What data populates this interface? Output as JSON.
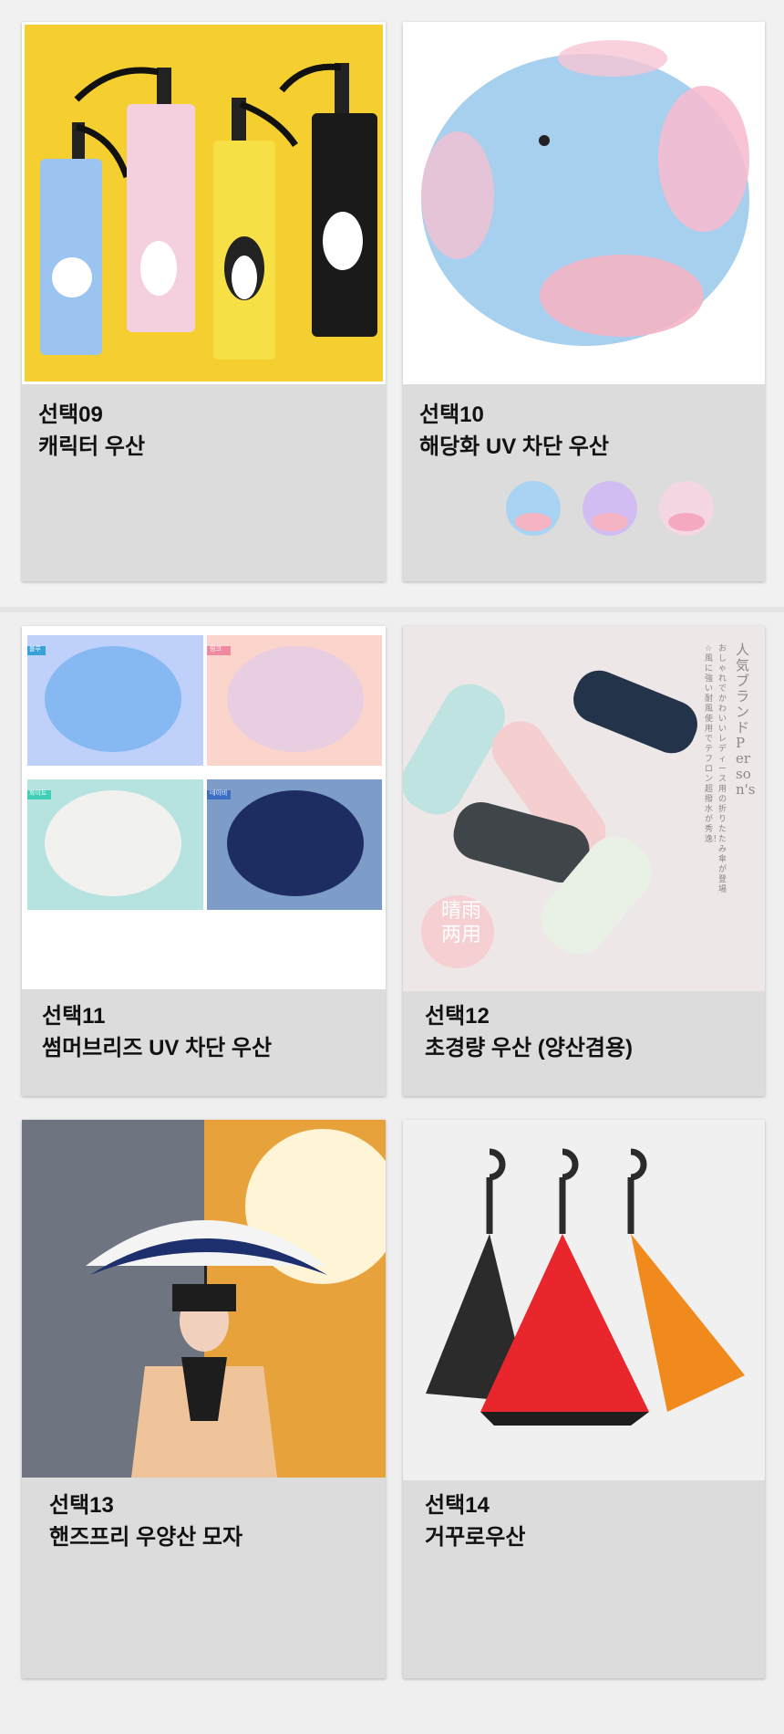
{
  "products": [
    {
      "code": "선택09",
      "name": "캐릭터 우산",
      "icon": "character-umbrella-photo"
    },
    {
      "code": "선택10",
      "name": "해당화 UV 차단 우산",
      "icon": "flower-uv-umbrella-photo"
    },
    {
      "code": "선택11",
      "name": "썸머브리즈 UV 차단 우산",
      "icon": "summer-breeze-umbrella-photo"
    },
    {
      "code": "선택12",
      "name": "초경량 우산 (양산겸용)",
      "icon": "ultralight-umbrella-photo"
    },
    {
      "code": "선택13",
      "name": "핸즈프리 우양산 모자",
      "icon": "handsfree-umbrella-hat-photo"
    },
    {
      "code": "선택14",
      "name": "거꾸로우산",
      "icon": "reverse-umbrella-photo"
    }
  ],
  "variant_tags": [
    "블루",
    "핑크",
    "화이트",
    "네이비"
  ],
  "overlay_text": {
    "brand_vertical": "人気ブランドPerson's",
    "jp_line1": "おしゃれでかわいいレディース用の折りたたみ傘が登場",
    "jp_line2": "☆風に強い耐風使用でテフロン超撥水が秀逸！",
    "stamp_line1": "晴雨",
    "stamp_line2": "两用"
  },
  "colors": {
    "page_bg": "#efefef",
    "card_label_bg": "#dcdcdc",
    "text": "#111111",
    "reverse_umbrella": [
      "#2b2b2b",
      "#e8262b",
      "#f18a1d"
    ]
  }
}
